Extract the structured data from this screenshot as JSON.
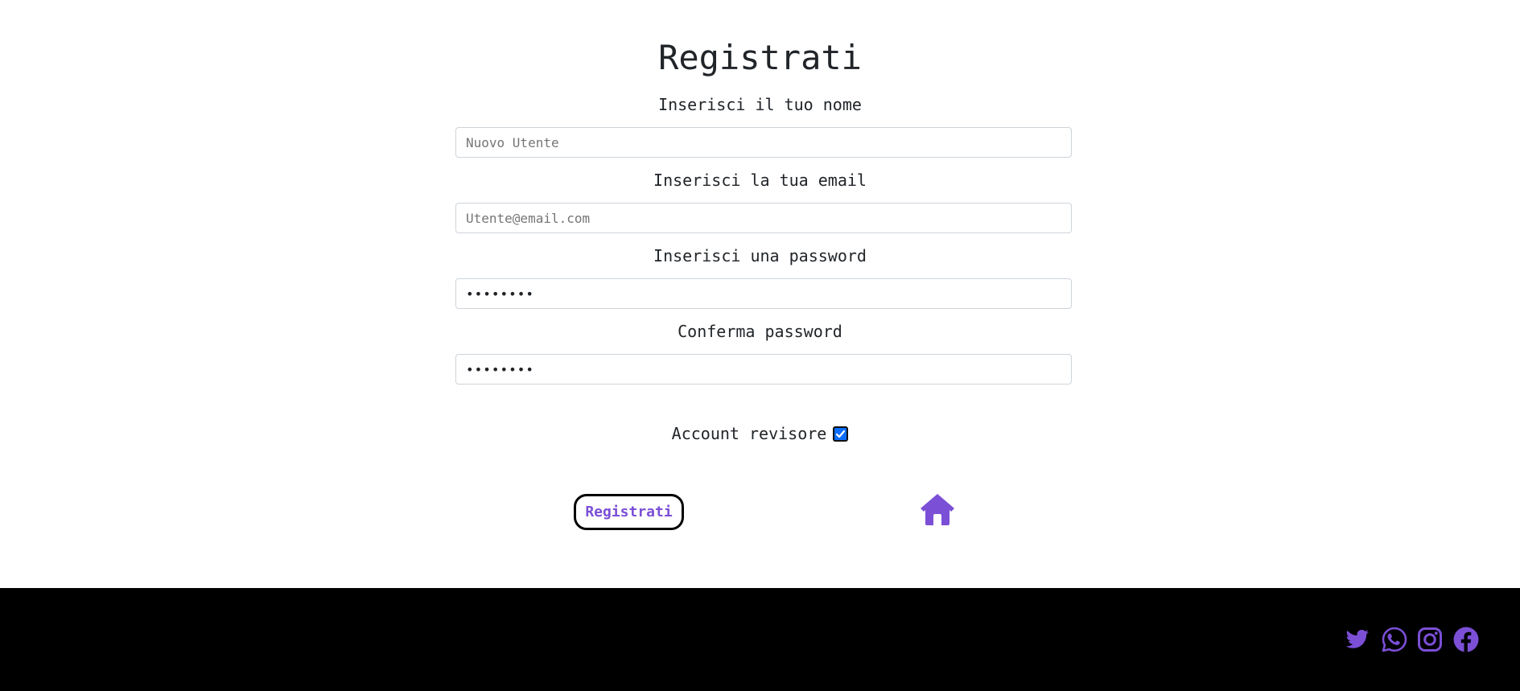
{
  "form": {
    "title": "Registrati",
    "name_label": "Inserisci il tuo nome",
    "name_placeholder": "Nuovo Utente",
    "email_label": "Inserisci la tua email",
    "email_placeholder": "Utente@email.com",
    "password_label": "Inserisci una password",
    "password_value": "********",
    "confirm_label": "Conferma password",
    "confirm_value": "********",
    "reviewer_label": "Account revisore",
    "reviewer_checked": true,
    "submit_label": "Registrati"
  },
  "icons": {
    "home": "home-icon",
    "social": [
      "twitter-icon",
      "whatsapp-icon",
      "instagram-icon",
      "facebook-icon"
    ]
  },
  "colors": {
    "accent": "#7b4fd6",
    "footer_bg": "#000000",
    "checkbox": "#0d6efd"
  }
}
